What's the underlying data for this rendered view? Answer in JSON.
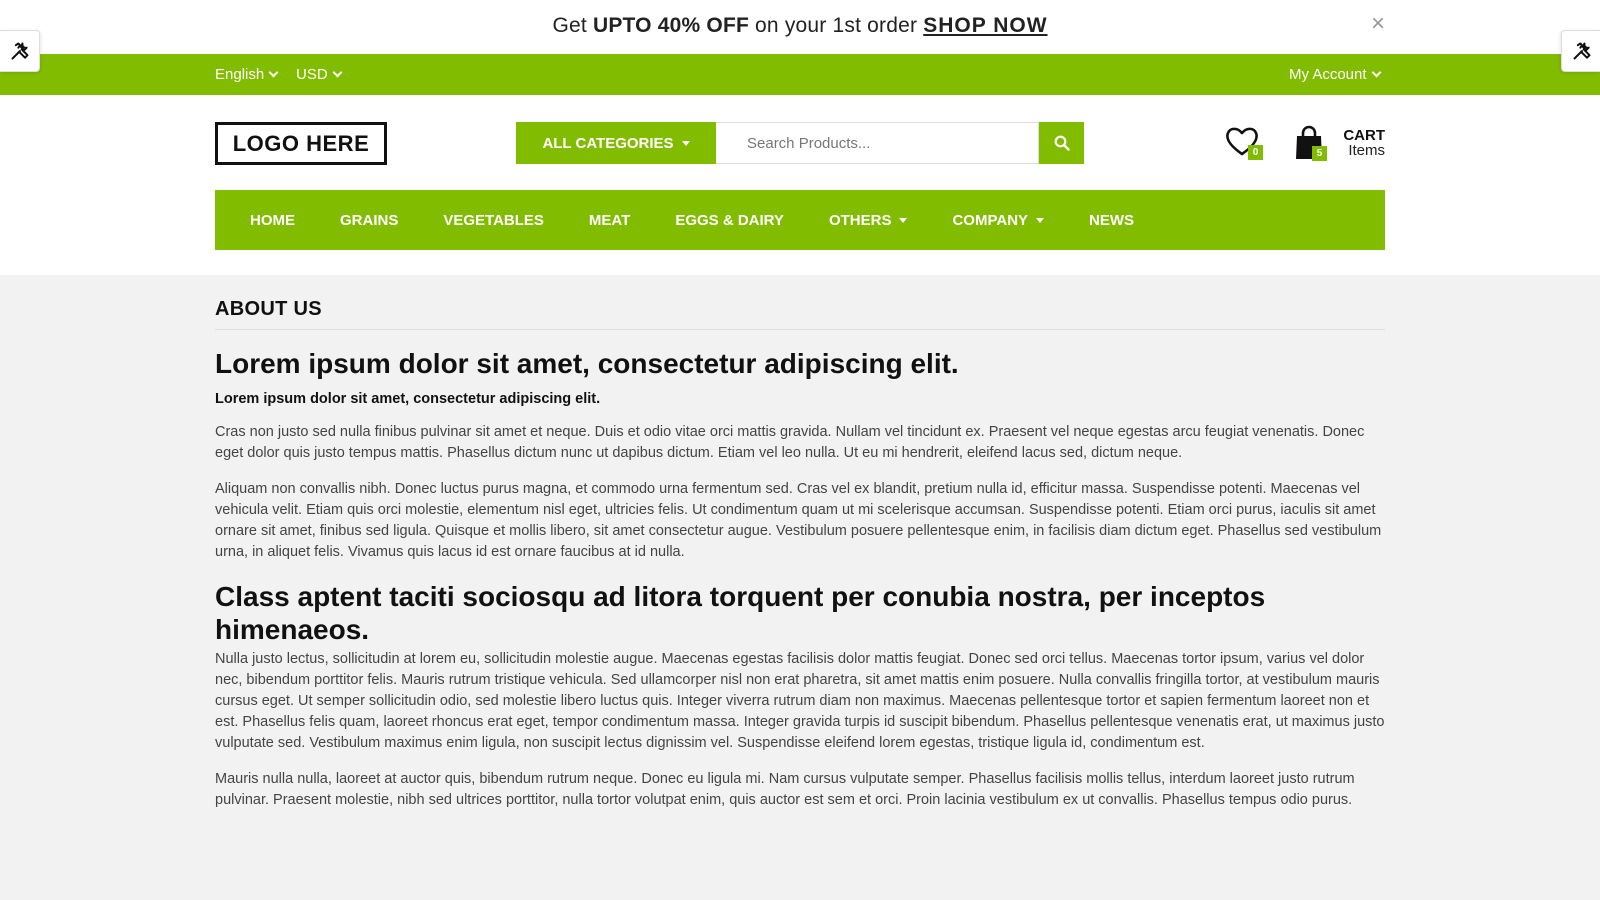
{
  "promo": {
    "prefix": "Get ",
    "highlight": "UPTO 40% OFF",
    "middle": " on your 1st order ",
    "link": "SHOP NOW",
    "close": "×"
  },
  "topbar": {
    "language": "English",
    "currency": "USD",
    "account": "My Account"
  },
  "header": {
    "logo": "LOGO HERE",
    "categories_label": "ALL CATEGORIES",
    "search_placeholder": "Search Products...",
    "wishlist_count": "0",
    "cart_count": "5",
    "cart_label": "CART",
    "cart_sublabel": "Items"
  },
  "nav": {
    "items": [
      {
        "label": "HOME",
        "dropdown": false
      },
      {
        "label": "GRAINS",
        "dropdown": false
      },
      {
        "label": "VEGETABLES",
        "dropdown": false
      },
      {
        "label": "MEAT",
        "dropdown": false
      },
      {
        "label": "EGGS & DAIRY",
        "dropdown": false
      },
      {
        "label": "OTHERS",
        "dropdown": true
      },
      {
        "label": "COMPANY",
        "dropdown": true
      },
      {
        "label": "NEWS",
        "dropdown": false
      }
    ]
  },
  "content": {
    "section_title": "ABOUT US",
    "heading1": "Lorem ipsum dolor sit amet, consectetur adipiscing elit.",
    "subheading": "Lorem ipsum dolor sit amet, consectetur adipiscing elit.",
    "para1": "Cras non justo sed nulla finibus pulvinar sit amet et neque. Duis et odio vitae orci mattis gravida. Nullam vel tincidunt ex. Praesent vel neque egestas arcu feugiat venenatis. Donec eget dolor quis justo tempus mattis. Phasellus dictum nunc ut dapibus dictum. Etiam vel leo nulla. Ut eu mi hendrerit, eleifend lacus sed, dictum neque.",
    "para2": "Aliquam non convallis nibh. Donec luctus purus magna, et commodo urna fermentum sed. Cras vel ex blandit, pretium nulla id, efficitur massa. Suspendisse potenti. Maecenas vel vehicula velit. Etiam quis orci molestie, elementum nisl eget, ultricies felis. Ut condimentum quam ut mi scelerisque accumsan. Suspendisse potenti. Etiam orci purus, iaculis sit amet ornare sit amet, finibus sed ligula. Quisque et mollis libero, sit amet consectetur augue. Vestibulum posuere pellentesque enim, in facilisis diam dictum eget. Phasellus sed vestibulum urna, in aliquet felis. Vivamus quis lacus id est ornare faucibus at id nulla.",
    "heading2": "Class aptent taciti sociosqu ad litora torquent per conubia nostra, per inceptos himenaeos.",
    "para3": "Nulla justo lectus, sollicitudin at lorem eu, sollicitudin molestie augue. Maecenas egestas facilisis dolor mattis feugiat. Donec sed orci tellus. Maecenas tortor ipsum, varius vel dolor nec, bibendum porttitor felis. Mauris rutrum tristique vehicula. Sed ullamcorper nisl non erat pharetra, sit amet mattis enim posuere. Nulla convallis fringilla tortor, at vestibulum mauris cursus eget. Ut semper sollicitudin odio, sed molestie libero luctus quis. Integer viverra rutrum diam non maximus. Maecenas pellentesque tortor et sapien fermentum laoreet non et est. Phasellus felis quam, laoreet rhoncus erat eget, tempor condimentum massa. Integer gravida turpis id suscipit bibendum. Phasellus pellentesque venenatis erat, ut maximus justo vulputate sed. Vestibulum maximus enim ligula, non suscipit lectus dignissim vel. Suspendisse eleifend lorem egestas, tristique ligula id, condimentum est.",
    "para4": "Mauris nulla nulla, laoreet at auctor quis, bibendum rutrum neque. Donec eu ligula mi. Nam cursus vulputate semper. Phasellus facilisis mollis tellus, interdum laoreet justo rutrum pulvinar. Praesent molestie, nibh sed ultrices porttitor, nulla tortor volutpat enim, quis auctor est sem et orci. Proin lacinia vestibulum ex ut convallis. Phasellus tempus odio purus."
  },
  "colors": {
    "accent": "#82bc00",
    "page_bg": "#f2f2f2"
  },
  "icons": [
    "tools-icon",
    "close-icon",
    "search-icon",
    "heart-icon",
    "shopping-bag-icon",
    "chevron-down-icon",
    "caret-down-icon"
  ]
}
